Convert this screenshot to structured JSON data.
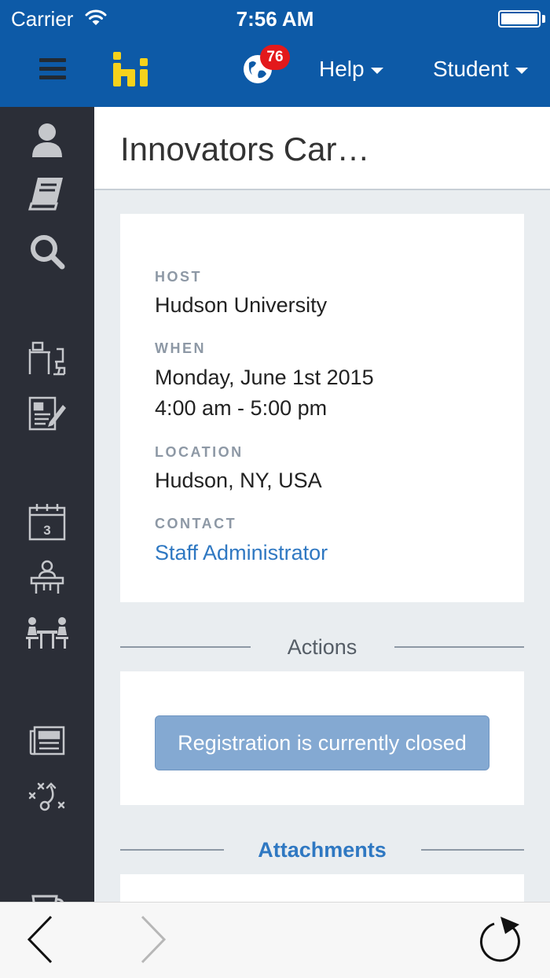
{
  "status_bar": {
    "carrier": "Carrier",
    "time": "7:56 AM"
  },
  "header": {
    "logo_text": "hi",
    "notification_count": "76",
    "help_label": "Help",
    "user_label": "Student"
  },
  "page": {
    "title": "Innovators Car…"
  },
  "event": {
    "host_label": "HOST",
    "host": "Hudson University",
    "when_label": "WHEN",
    "date": "Monday, June 1st 2015",
    "time": "4:00 am - 5:00 pm",
    "location_label": "LOCATION",
    "location": "Hudson, NY, USA",
    "contact_label": "CONTACT",
    "contact": "Staff Administrator"
  },
  "actions": {
    "heading": "Actions",
    "registration_button": "Registration is currently closed"
  },
  "attachments": {
    "heading": "Attachments"
  },
  "sidebar": {
    "icons": [
      "profile-icon",
      "book-icon",
      "search-icon",
      "desk-icon",
      "document-edit-icon",
      "calendar-icon",
      "presenter-icon",
      "meeting-icon",
      "news-icon",
      "strategy-icon",
      "cup-icon"
    ],
    "calendar_day": "3"
  },
  "colors": {
    "header_bg": "#0d5aa7",
    "sidebar_bg": "#2b2e37",
    "link": "#2f78c2",
    "badge": "#e3191b",
    "disabled_button": "#84a9d2"
  }
}
